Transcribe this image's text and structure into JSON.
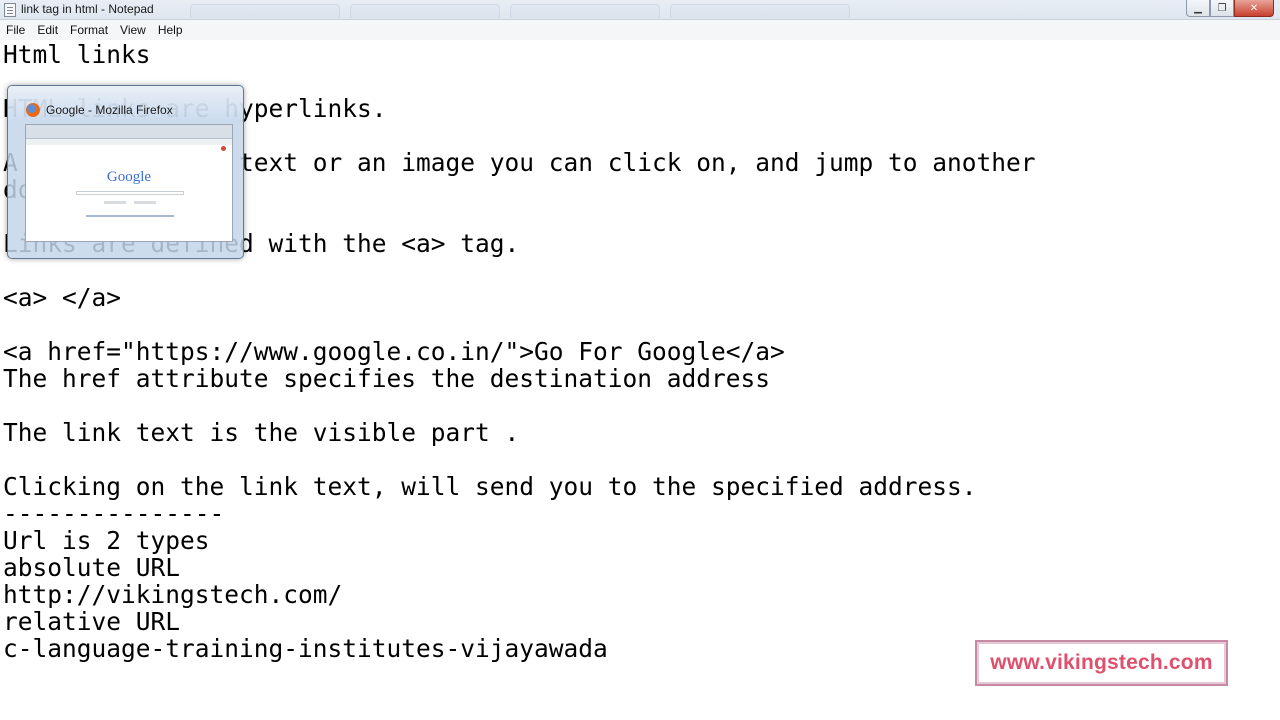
{
  "window": {
    "title": "link tag in html - Notepad",
    "controls": {
      "minimize_glyph": "▁",
      "maximize_glyph": "❐",
      "close_glyph": "✕"
    }
  },
  "menu": {
    "items": [
      "File",
      "Edit",
      "Format",
      "View",
      "Help"
    ]
  },
  "editor": {
    "content": "Html links\n\nHTML links are hyperlinks.\n\nA link can be a text or an image you can click on, and jump to another\ndocument.\n\nLinks are defined with the <a> tag.\n\n<a> </a>\n\n<a href=\"https://www.google.co.in/\">Go For Google</a>\nThe href attribute specifies the destination address\n\nThe link text is the visible part .\n\nClicking on the link text, will send you to the specified address.\n---------------\nUrl is 2 types\nabsolute URL\nhttp://vikingstech.com/\nrelative URL\nc-language-training-institutes-vijayawada"
  },
  "taskbar_preview": {
    "title": "Google - Mozilla Firefox",
    "page_logo": "Google"
  },
  "watermark": {
    "text": "www.vikingstech.com"
  },
  "colors": {
    "watermark_text": "#e0506d",
    "watermark_border": "#c68aa4",
    "close_button": "#c8412d"
  },
  "icons": {
    "app": "notepad-icon",
    "preview": "firefox-icon"
  }
}
